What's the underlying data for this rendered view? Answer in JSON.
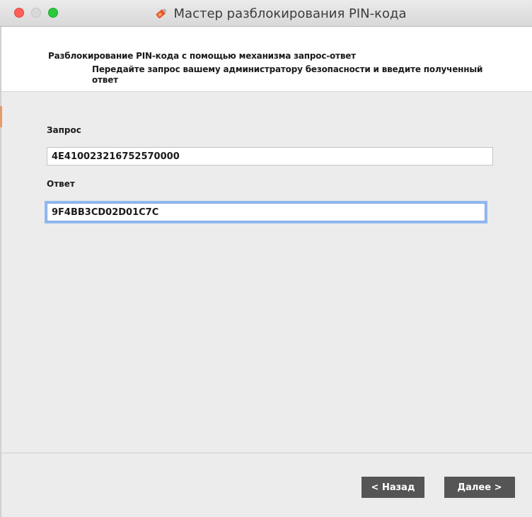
{
  "window": {
    "title": "Мастер разблокирования PIN-кода",
    "title_icon": "usb-token-icon"
  },
  "header": {
    "title": "Разблокирование PIN-кода с помощью механизма запрос-ответ",
    "description": "Передайте запрос вашему администратору безопасности и введите полученный ответ"
  },
  "form": {
    "request_label": "Запрос",
    "request_value": "4E410023216752570000",
    "response_label": "Ответ",
    "response_value": "9F4BB3CD02D01C7C"
  },
  "footer": {
    "back_label": "< Назад",
    "next_label": "Далее >"
  },
  "colors": {
    "button_bg": "#555555",
    "focus_ring": "#94b9f0",
    "close": "#fe5f57",
    "maximize": "#2ac940"
  }
}
